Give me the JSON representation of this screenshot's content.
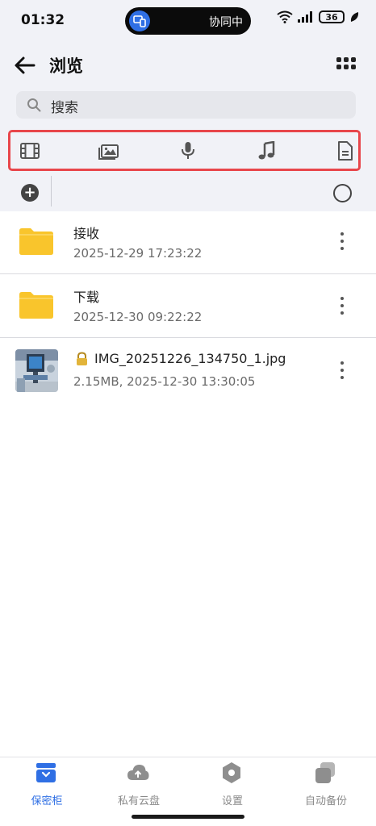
{
  "status_bar": {
    "time": "01:32",
    "island_text": "协同中",
    "battery": "36"
  },
  "header": {
    "title": "浏览"
  },
  "search": {
    "placeholder": "搜索"
  },
  "categories": [
    "video-icon",
    "image-icon",
    "microphone-icon",
    "music-icon",
    "document-icon"
  ],
  "files": [
    {
      "name": "接收",
      "meta": "2025-12-29 17:23:22",
      "type": "folder"
    },
    {
      "name": "下载",
      "meta": "2025-12-30 09:22:22",
      "type": "folder"
    },
    {
      "name": "IMG_20251226_134750_1.jpg",
      "meta": "2.15MB, 2025-12-30 13:30:05",
      "type": "image",
      "locked": true
    }
  ],
  "bottom_nav": [
    {
      "label": "保密柜",
      "icon": "vault-icon",
      "active": true
    },
    {
      "label": "私有云盘",
      "icon": "cloud-icon",
      "active": false
    },
    {
      "label": "设置",
      "icon": "settings-icon",
      "active": false
    },
    {
      "label": "自动备份",
      "icon": "backup-icon",
      "active": false
    }
  ],
  "colors": {
    "accent": "#2f6fe4",
    "highlight": "#e8464b",
    "folder": "#f9c52c"
  }
}
